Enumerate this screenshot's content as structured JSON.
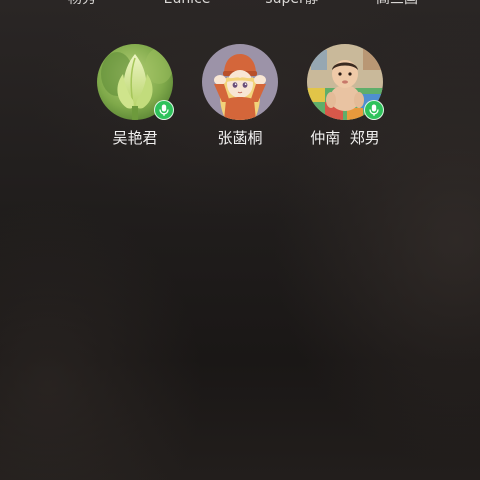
{
  "top_names": [
    "杨秀",
    "Eunice",
    "super静",
    "高三国"
  ],
  "participants": [
    {
      "name": "吴艳君",
      "avatar_icon": "lotus-bud-photo",
      "mic_on": true
    },
    {
      "name": "张菡桐",
      "avatar_icon": "cartoon-girl-illustration",
      "mic_on": false
    },
    {
      "name": "仲南  郑男",
      "avatar_icon": "baby-photo",
      "mic_on": true
    }
  ],
  "colors": {
    "mic_badge": "#2fc25b",
    "text": "#f0efee"
  }
}
